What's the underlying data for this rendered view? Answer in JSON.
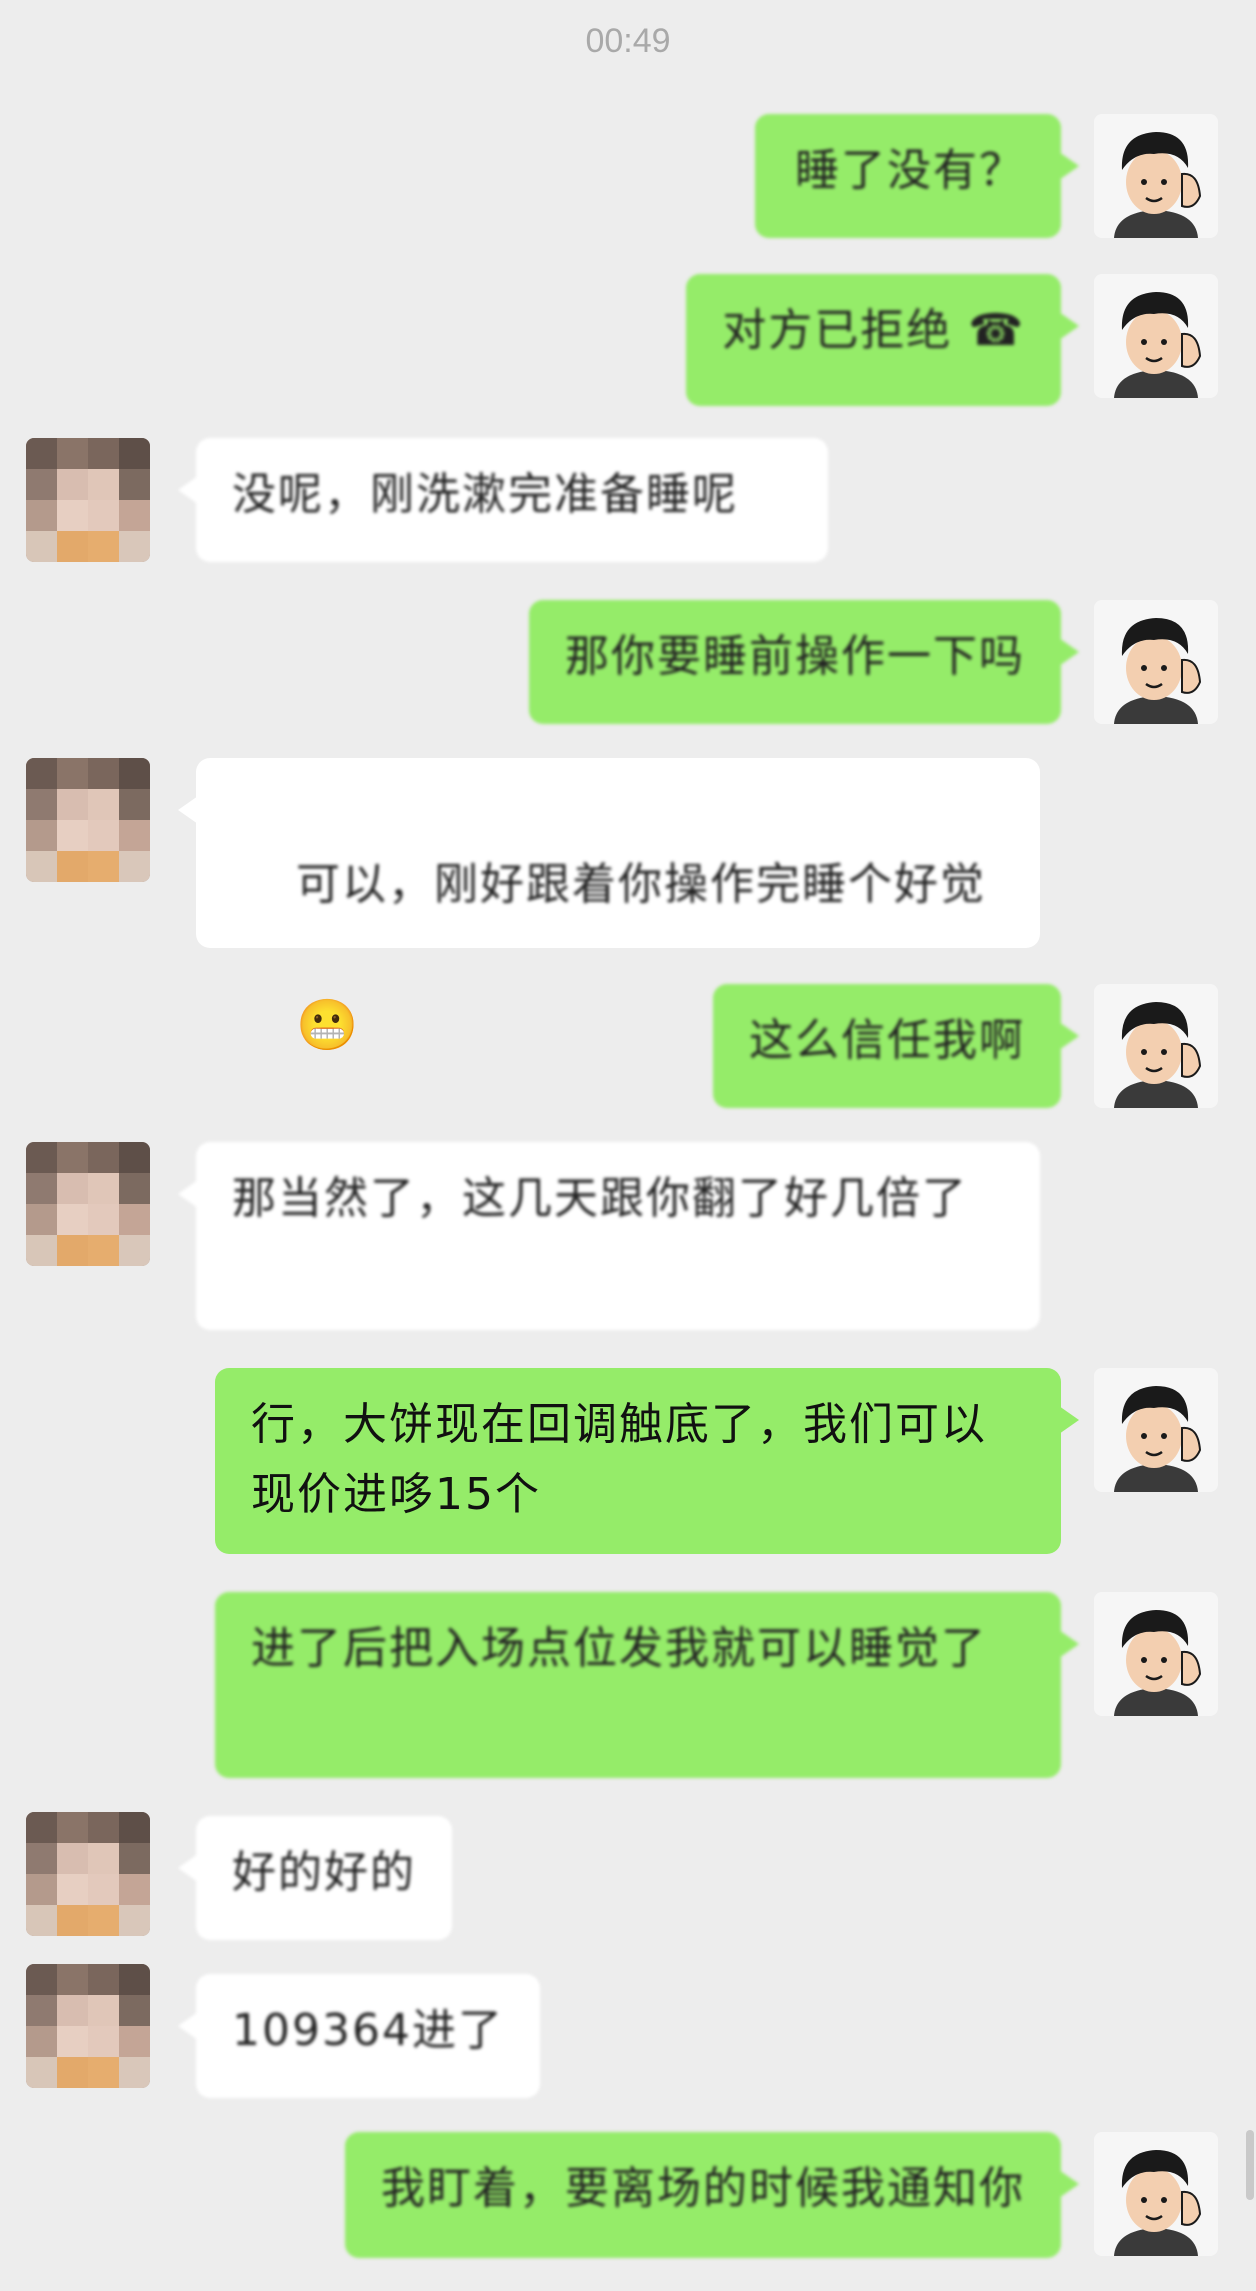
{
  "status_time": "00:49",
  "colors": {
    "background": "#ededed",
    "self_bubble": "#95ec69",
    "peer_bubble": "#ffffff",
    "time_text": "#a9a9a9"
  },
  "messages": [
    {
      "side": "self",
      "text": "睡了没有？"
    },
    {
      "side": "self",
      "text": "对方已拒绝 ☎"
    },
    {
      "side": "peer",
      "text": "没呢，刚洗漱完准备睡呢"
    },
    {
      "side": "self",
      "text": "那你要睡前操作一下吗"
    },
    {
      "side": "peer",
      "text": "可以，刚好跟着你操作完睡个好觉",
      "emoji": "😬"
    },
    {
      "side": "self",
      "text": "这么信任我啊"
    },
    {
      "side": "peer",
      "text": "那当然了，这几天跟你翻了好几倍了"
    },
    {
      "side": "self",
      "text": "行，大饼现在回调触底了，我们可以现价进哆15个"
    },
    {
      "side": "self",
      "text": "进了后把入场点位发我就可以睡觉了"
    },
    {
      "side": "peer",
      "text": "好的好的"
    },
    {
      "side": "peer",
      "text": "109364进了"
    },
    {
      "side": "self",
      "text": "我盯着，要离场的时候我通知你"
    }
  ],
  "icons": {
    "self_avatar": "cartoon-boy-avatar-icon",
    "peer_avatar": "pixelated-avatar-icon"
  }
}
